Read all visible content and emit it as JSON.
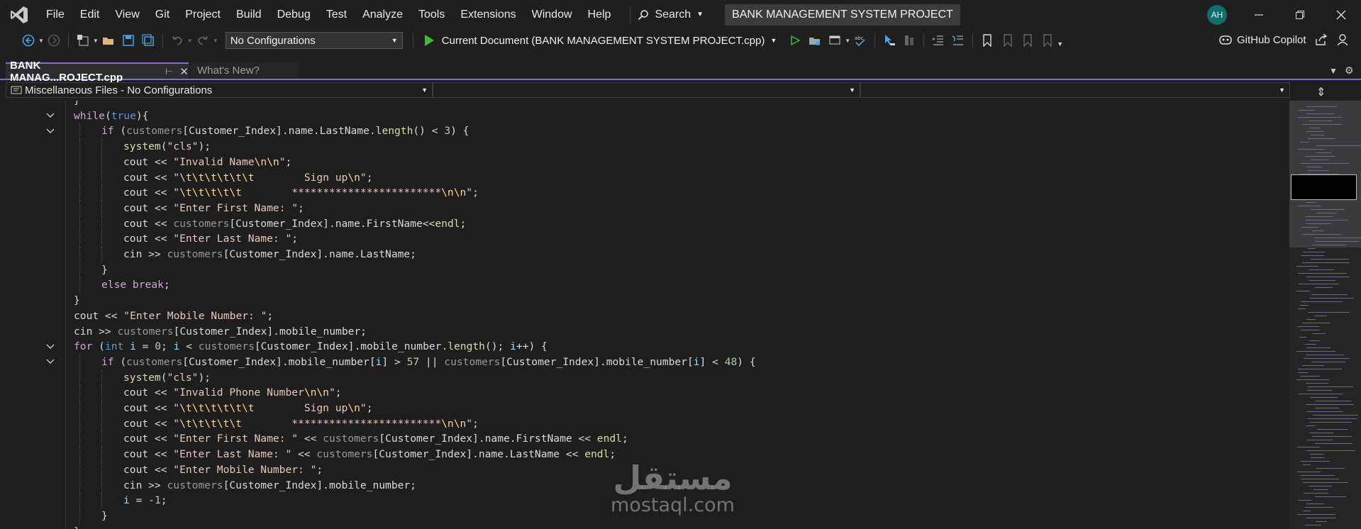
{
  "menu": [
    "File",
    "Edit",
    "View",
    "Git",
    "Project",
    "Build",
    "Debug",
    "Test",
    "Analyze",
    "Tools",
    "Extensions",
    "Window",
    "Help"
  ],
  "search_label": "Search",
  "solution_title": "BANK MANAGEMENT SYSTEM PROJECT",
  "avatar_initials": "AH",
  "toolbar": {
    "config_value": "No Configurations",
    "run_target": "Current Document (BANK MANAGEMENT SYSTEM PROJECT.cpp)",
    "copilot_label": "GitHub Copilot"
  },
  "tabs": {
    "active": "BANK MANAG...ROJECT.cpp",
    "second": "What's New?"
  },
  "navbar": {
    "project_scope": "Miscellaneous Files - No Configurations"
  },
  "editor": {
    "lines": [
      [
        [
          "pl",
          "}"
        ]
      ],
      [
        [
          "kw-c",
          "while"
        ],
        [
          "pl",
          "("
        ],
        [
          "kw-b",
          "true"
        ],
        [
          "pl",
          "){"
        ]
      ],
      [
        [
          "kw-c",
          "if"
        ],
        [
          "pl",
          " ("
        ],
        [
          "gvar",
          "customers"
        ],
        [
          "pl",
          "[Customer_Index]."
        ],
        [
          "mb",
          "name"
        ],
        [
          "pl",
          "."
        ],
        [
          "mb",
          "LastName"
        ],
        [
          "pl",
          "."
        ],
        [
          "fn",
          "length"
        ],
        [
          "pl",
          "() < "
        ],
        [
          "num",
          "3"
        ],
        [
          "pl",
          ") {"
        ]
      ],
      [
        [
          "fn",
          "system"
        ],
        [
          "pl",
          "("
        ],
        [
          "str",
          "\"cls\""
        ],
        [
          "pl",
          ");"
        ]
      ],
      [
        [
          "pl",
          "cout << "
        ],
        [
          "str",
          "\"Invalid Name"
        ],
        [
          "esc",
          "\\n\\n"
        ],
        [
          "str",
          "\""
        ],
        [
          "pl",
          ";"
        ]
      ],
      [
        [
          "pl",
          "cout << "
        ],
        [
          "str",
          "\""
        ],
        [
          "esc",
          "\\t\\t\\t\\t\\t\\t"
        ],
        [
          "str",
          "        Sign up"
        ],
        [
          "esc",
          "\\n"
        ],
        [
          "str",
          "\""
        ],
        [
          "pl",
          ";"
        ]
      ],
      [
        [
          "pl",
          "cout << "
        ],
        [
          "str",
          "\""
        ],
        [
          "esc",
          "\\t\\t\\t\\t\\t"
        ],
        [
          "str",
          "        ************************"
        ],
        [
          "esc",
          "\\n\\n"
        ],
        [
          "str",
          "\""
        ],
        [
          "pl",
          ";"
        ]
      ],
      [
        [
          "pl",
          "cout << "
        ],
        [
          "str",
          "\"Enter First Name: \""
        ],
        [
          "pl",
          ";"
        ]
      ],
      [
        [
          "pl",
          "cout << "
        ],
        [
          "gvar",
          "customers"
        ],
        [
          "pl",
          "[Customer_Index].name.FirstName<<"
        ],
        [
          "fn",
          "endl"
        ],
        [
          "pl",
          ";"
        ]
      ],
      [
        [
          "pl",
          "cout << "
        ],
        [
          "str",
          "\"Enter Last Name: \""
        ],
        [
          "pl",
          ";"
        ]
      ],
      [
        [
          "pl",
          "cin >> "
        ],
        [
          "gvar",
          "customers"
        ],
        [
          "pl",
          "[Customer_Index].name.LastName;"
        ]
      ],
      [
        [
          "pl",
          "}"
        ]
      ],
      [
        [
          "kw-c",
          "else break"
        ],
        [
          "pl",
          ";"
        ]
      ],
      [
        [
          "pl",
          "}"
        ]
      ],
      [
        [
          "pl",
          "cout << "
        ],
        [
          "str",
          "\"Enter Mobile Number: \""
        ],
        [
          "pl",
          ";"
        ]
      ],
      [
        [
          "pl",
          "cin >> "
        ],
        [
          "gvar",
          "customers"
        ],
        [
          "pl",
          "[Customer_Index].mobile_number;"
        ]
      ],
      [
        [
          "kw-c",
          "for"
        ],
        [
          "pl",
          " ("
        ],
        [
          "kw-b",
          "int"
        ],
        [
          "pl",
          " "
        ],
        [
          "var",
          "i"
        ],
        [
          "pl",
          " = "
        ],
        [
          "num",
          "0"
        ],
        [
          "pl",
          "; "
        ],
        [
          "var",
          "i"
        ],
        [
          "pl",
          " < "
        ],
        [
          "gvar",
          "customers"
        ],
        [
          "pl",
          "[Customer_Index].mobile_number."
        ],
        [
          "fn",
          "length"
        ],
        [
          "pl",
          "(); "
        ],
        [
          "var",
          "i"
        ],
        [
          "pl",
          "++) {"
        ]
      ],
      [
        [
          "kw-c",
          "if"
        ],
        [
          "pl",
          " ("
        ],
        [
          "gvar",
          "customers"
        ],
        [
          "pl",
          "[Customer_Index].mobile_number["
        ],
        [
          "var",
          "i"
        ],
        [
          "pl",
          "] > "
        ],
        [
          "num",
          "57"
        ],
        [
          "pl",
          " || "
        ],
        [
          "gvar",
          "customers"
        ],
        [
          "pl",
          "[Customer_Index].mobile_number["
        ],
        [
          "var",
          "i"
        ],
        [
          "pl",
          "] < "
        ],
        [
          "num",
          "48"
        ],
        [
          "pl",
          ") {"
        ]
      ],
      [
        [
          "fn",
          "system"
        ],
        [
          "pl",
          "("
        ],
        [
          "str",
          "\"cls\""
        ],
        [
          "pl",
          ");"
        ]
      ],
      [
        [
          "pl",
          "cout << "
        ],
        [
          "str",
          "\"Invalid Phone Number"
        ],
        [
          "esc",
          "\\n\\n"
        ],
        [
          "str",
          "\""
        ],
        [
          "pl",
          ";"
        ]
      ],
      [
        [
          "pl",
          "cout << "
        ],
        [
          "str",
          "\""
        ],
        [
          "esc",
          "\\t\\t\\t\\t\\t\\t"
        ],
        [
          "str",
          "        Sign up"
        ],
        [
          "esc",
          "\\n"
        ],
        [
          "str",
          "\""
        ],
        [
          "pl",
          ";"
        ]
      ],
      [
        [
          "pl",
          "cout << "
        ],
        [
          "str",
          "\""
        ],
        [
          "esc",
          "\\t\\t\\t\\t\\t"
        ],
        [
          "str",
          "        ************************"
        ],
        [
          "esc",
          "\\n\\n"
        ],
        [
          "str",
          "\""
        ],
        [
          "pl",
          ";"
        ]
      ],
      [
        [
          "pl",
          "cout << "
        ],
        [
          "str",
          "\"Enter First Name: \""
        ],
        [
          "pl",
          " << "
        ],
        [
          "gvar",
          "customers"
        ],
        [
          "pl",
          "[Customer_Index].name.FirstName << "
        ],
        [
          "fn",
          "endl"
        ],
        [
          "pl",
          ";"
        ]
      ],
      [
        [
          "pl",
          "cout << "
        ],
        [
          "str",
          "\"Enter Last Name: \""
        ],
        [
          "pl",
          " << "
        ],
        [
          "gvar",
          "customers"
        ],
        [
          "pl",
          "[Customer_Index].name.LastName << "
        ],
        [
          "fn",
          "endl"
        ],
        [
          "pl",
          ";"
        ]
      ],
      [
        [
          "pl",
          "cout << "
        ],
        [
          "str",
          "\"Enter Mobile Number: \""
        ],
        [
          "pl",
          ";"
        ]
      ],
      [
        [
          "pl",
          "cin >> "
        ],
        [
          "gvar",
          "customers"
        ],
        [
          "pl",
          "[Customer_Index].mobile_number;"
        ]
      ],
      [
        [
          "var",
          "i"
        ],
        [
          "pl",
          " = -"
        ],
        [
          "num",
          "1"
        ],
        [
          "pl",
          ";"
        ]
      ],
      [
        [
          "pl",
          "}"
        ]
      ],
      [
        [
          "pl",
          "}"
        ]
      ]
    ]
  },
  "watermark": {
    "arabic": "مستقل",
    "latin": "mostaql.com"
  }
}
